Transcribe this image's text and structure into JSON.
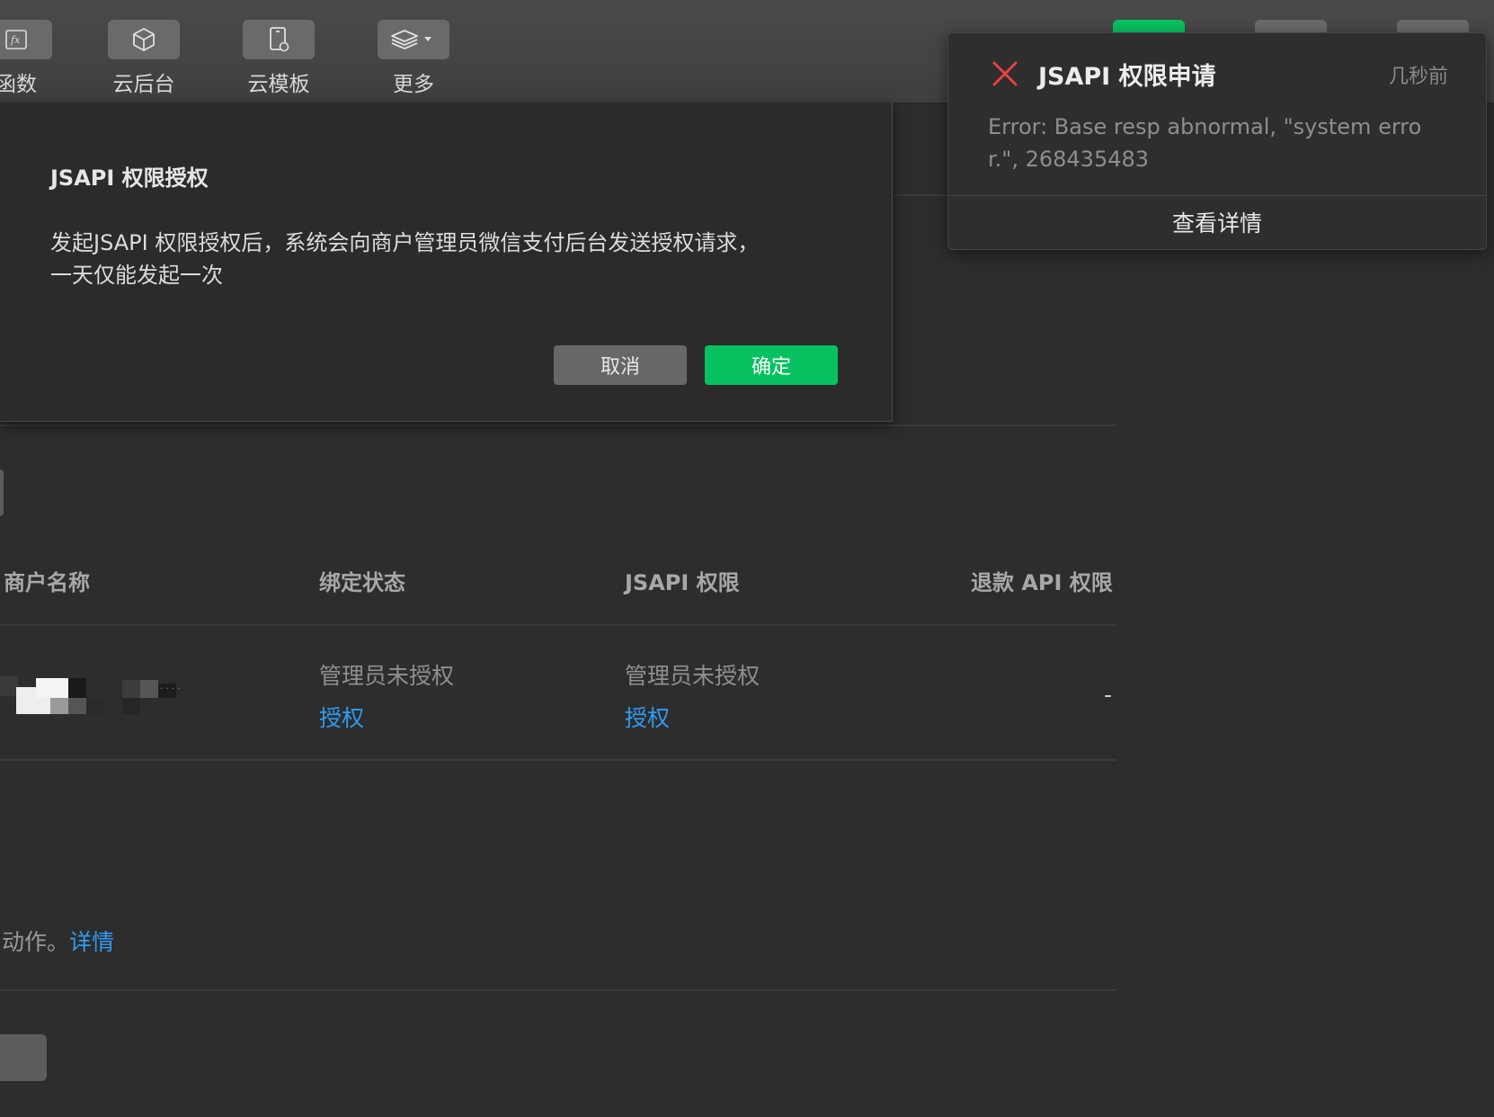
{
  "toolbar": {
    "items": [
      {
        "label": "函数",
        "icon": "function-icon"
      },
      {
        "label": "云后台",
        "icon": "cube-icon"
      },
      {
        "label": "云模板",
        "icon": "template-icon"
      },
      {
        "label": "更多",
        "icon": "layers-icon"
      }
    ]
  },
  "dialog": {
    "title": "JSAPI 权限授权",
    "body_line1": "发起JSAPI 权限授权后，系统会向商户管理员微信支付后台发送授权请求，",
    "body_line2": "一天仅能发起一次",
    "cancel_label": "取消",
    "confirm_label": "确定"
  },
  "notification": {
    "title": "JSAPI 权限申请",
    "time": "几秒前",
    "message": "Error: Base resp abnormal, \"system error.\", 268435483",
    "detail_label": "查看详情",
    "icon": "close-icon",
    "icon_color": "#e64340"
  },
  "table": {
    "headers": [
      "商户名称",
      "绑定状态",
      "JSAPI 权限",
      "退款 API 权限"
    ],
    "rows": [
      {
        "bind_status": "管理员未授权",
        "bind_action": "授权",
        "jsapi_status": "管理员未授权",
        "jsapi_action": "授权",
        "refund": "-"
      }
    ]
  },
  "footer": {
    "text": "动作。",
    "link": "详情"
  },
  "colors": {
    "accent_green": "#07c160",
    "link_blue": "#2f9bf0",
    "background": "#2d2d2d"
  }
}
